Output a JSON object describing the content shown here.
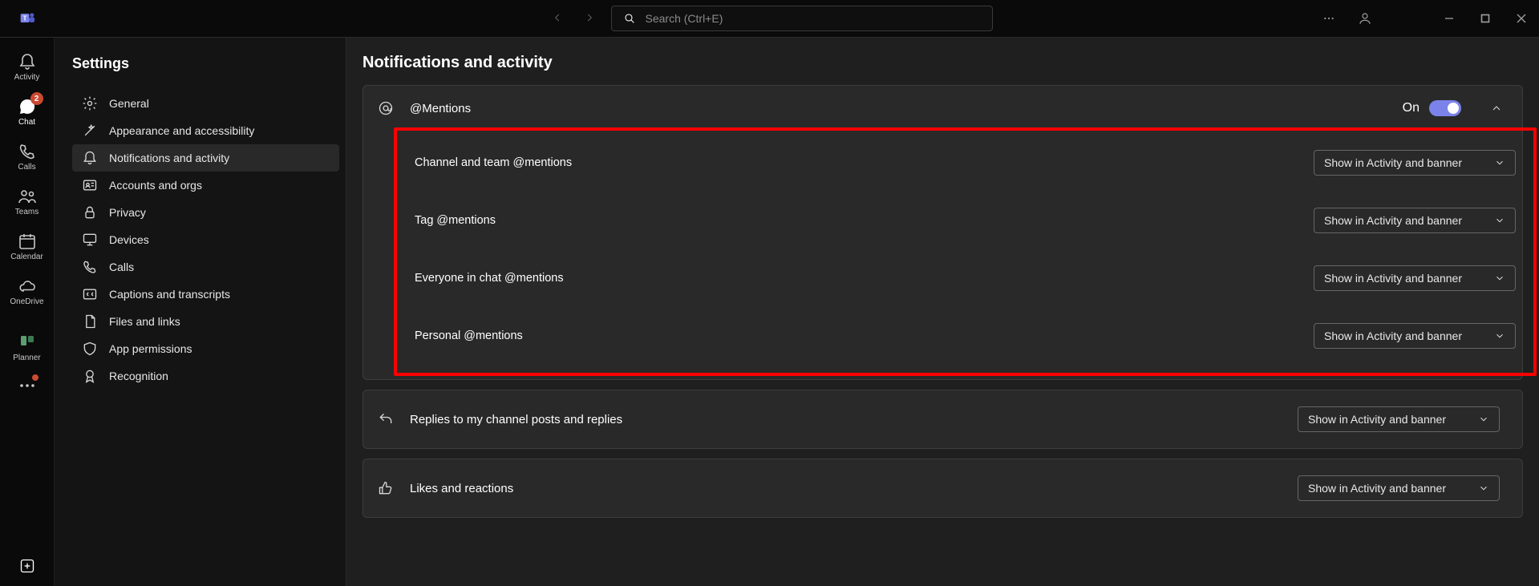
{
  "search_placeholder": "Search (Ctrl+E)",
  "rail": [
    {
      "label": "Activity"
    },
    {
      "label": "Chat",
      "badge": "2"
    },
    {
      "label": "Calls"
    },
    {
      "label": "Teams"
    },
    {
      "label": "Calendar"
    },
    {
      "label": "OneDrive"
    },
    {
      "label": "Planner"
    }
  ],
  "settings_title": "Settings",
  "sidebar": [
    {
      "label": "General"
    },
    {
      "label": "Appearance and accessibility"
    },
    {
      "label": "Notifications and activity"
    },
    {
      "label": "Accounts and orgs"
    },
    {
      "label": "Privacy"
    },
    {
      "label": "Devices"
    },
    {
      "label": "Calls"
    },
    {
      "label": "Captions and transcripts"
    },
    {
      "label": "Files and links"
    },
    {
      "label": "App permissions"
    },
    {
      "label": "Recognition"
    }
  ],
  "page_title": "Notifications and activity",
  "mentions": {
    "section_label": "@Mentions",
    "toggle_label": "On",
    "rows": [
      {
        "label": "Channel and team @mentions",
        "value": "Show in Activity and banner"
      },
      {
        "label": "Tag @mentions",
        "value": "Show in Activity and banner"
      },
      {
        "label": "Everyone in chat @mentions",
        "value": "Show in Activity and banner"
      },
      {
        "label": "Personal @mentions",
        "value": "Show in Activity and banner"
      }
    ]
  },
  "replies": {
    "label": "Replies to my channel posts and replies",
    "value": "Show in Activity and banner"
  },
  "likes": {
    "label": "Likes and reactions",
    "value": "Show in Activity and banner"
  }
}
